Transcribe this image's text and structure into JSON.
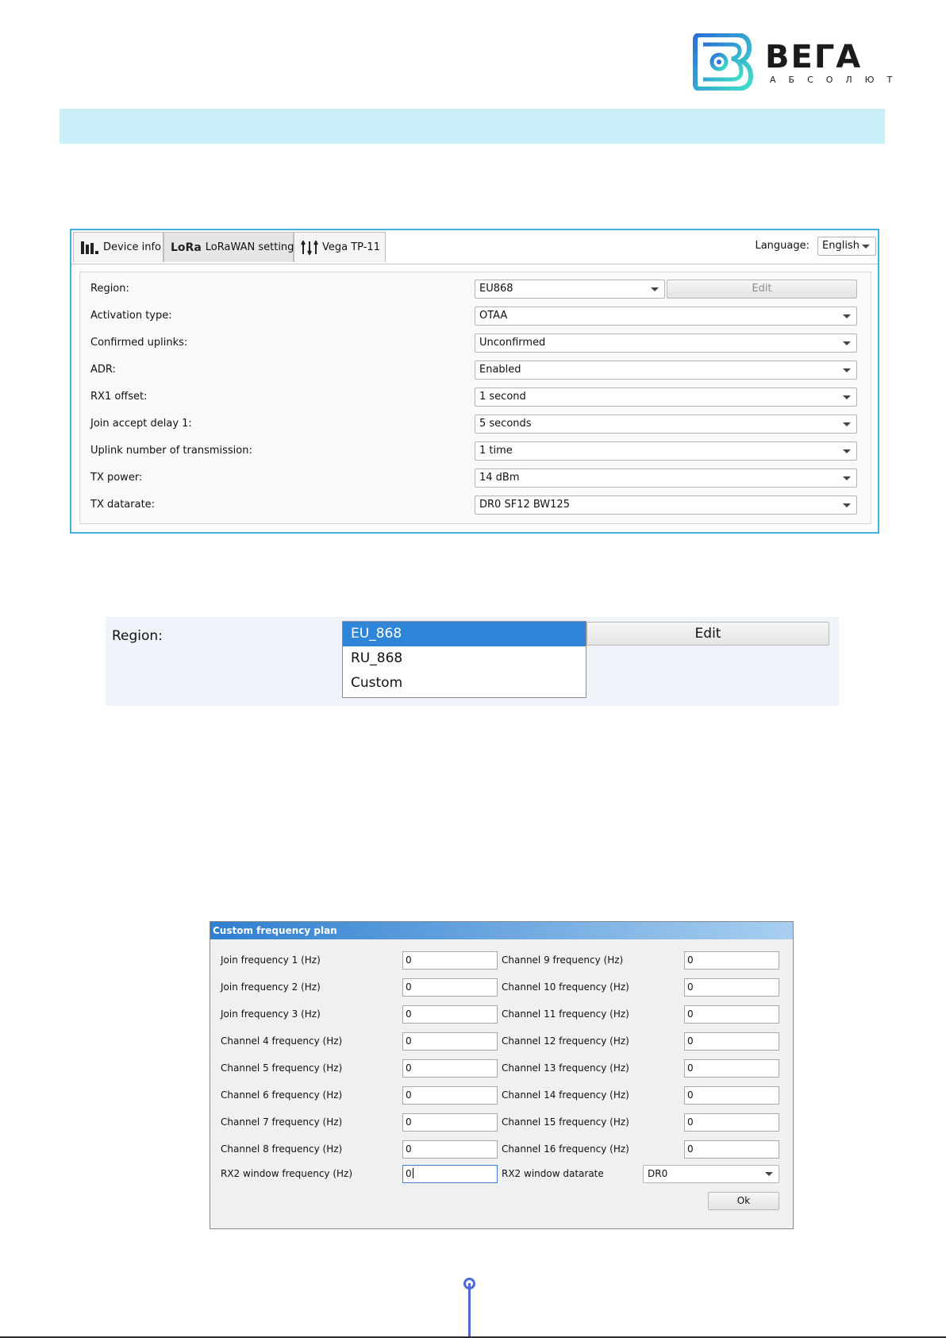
{
  "logo": {
    "brand": "ВЕГА",
    "tagline": "АБСОЛЮТ",
    "colors": {
      "gradient_start": "#2b6fd9",
      "gradient_end": "#3ee0c8",
      "text": "#1b1b1b"
    }
  },
  "window": {
    "tabs": [
      {
        "label": "Device info",
        "icon": "bar-chart-icon"
      },
      {
        "label": "LoRaWAN settings",
        "icon": "lora-logo-icon",
        "icon_text": "LoRa"
      },
      {
        "label": "Vega TP-11",
        "icon": "sliders-icon"
      }
    ],
    "language": {
      "label": "Language:",
      "value": "English"
    },
    "settings": [
      {
        "label": "Region:",
        "value": "EU868"
      },
      {
        "label": "Activation type:",
        "value": "OTAA"
      },
      {
        "label": "Confirmed uplinks:",
        "value": "Unconfirmed"
      },
      {
        "label": "ADR:",
        "value": "Enabled"
      },
      {
        "label": "RX1 offset:",
        "value": "1 second"
      },
      {
        "label": "Join accept delay 1:",
        "value": "5 seconds"
      },
      {
        "label": "Uplink number of transmission:",
        "value": "1 time"
      },
      {
        "label": "TX power:",
        "value": "14 dBm"
      },
      {
        "label": "TX datarate:",
        "value": "DR0 SF12 BW125"
      }
    ],
    "edit_label": "Edit",
    "accent": "#3fb4d6"
  },
  "region_dropdown": {
    "label": "Region:",
    "options": [
      "EU_868",
      "RU_868",
      "Custom"
    ],
    "selected": "EU_868",
    "edit_label": "Edit",
    "selected_color": "#2f85d8"
  },
  "dialog": {
    "title": "Custom frequency plan",
    "left_fields": [
      {
        "label": "Join frequency 1 (Hz)",
        "value": "0"
      },
      {
        "label": "Join frequency 2 (Hz)",
        "value": "0"
      },
      {
        "label": "Join frequency 3 (Hz)",
        "value": "0"
      },
      {
        "label": "Channel 4 frequency (Hz)",
        "value": "0"
      },
      {
        "label": "Channel 5 frequency (Hz)",
        "value": "0"
      },
      {
        "label": "Channel 6 frequency (Hz)",
        "value": "0"
      },
      {
        "label": "Channel 7 frequency (Hz)",
        "value": "0"
      },
      {
        "label": "Channel 8 frequency (Hz)",
        "value": "0"
      }
    ],
    "right_fields": [
      {
        "label": "Channel 9 frequency (Hz)",
        "value": "0"
      },
      {
        "label": "Channel 10 frequency (Hz)",
        "value": "0"
      },
      {
        "label": "Channel 11 frequency (Hz)",
        "value": "0"
      },
      {
        "label": "Channel 12 frequency (Hz)",
        "value": "0"
      },
      {
        "label": "Channel 13 frequency (Hz)",
        "value": "0"
      },
      {
        "label": "Channel 14 frequency (Hz)",
        "value": "0"
      },
      {
        "label": "Channel 15 frequency (Hz)",
        "value": "0"
      },
      {
        "label": "Channel 16 frequency (Hz)",
        "value": "0"
      }
    ],
    "rx2_frequency": {
      "label": "RX2 window frequency (Hz)",
      "value": "0"
    },
    "rx2_datarate": {
      "label": "RX2 window datarate",
      "value": "DR0"
    },
    "ok_label": "Ok"
  }
}
